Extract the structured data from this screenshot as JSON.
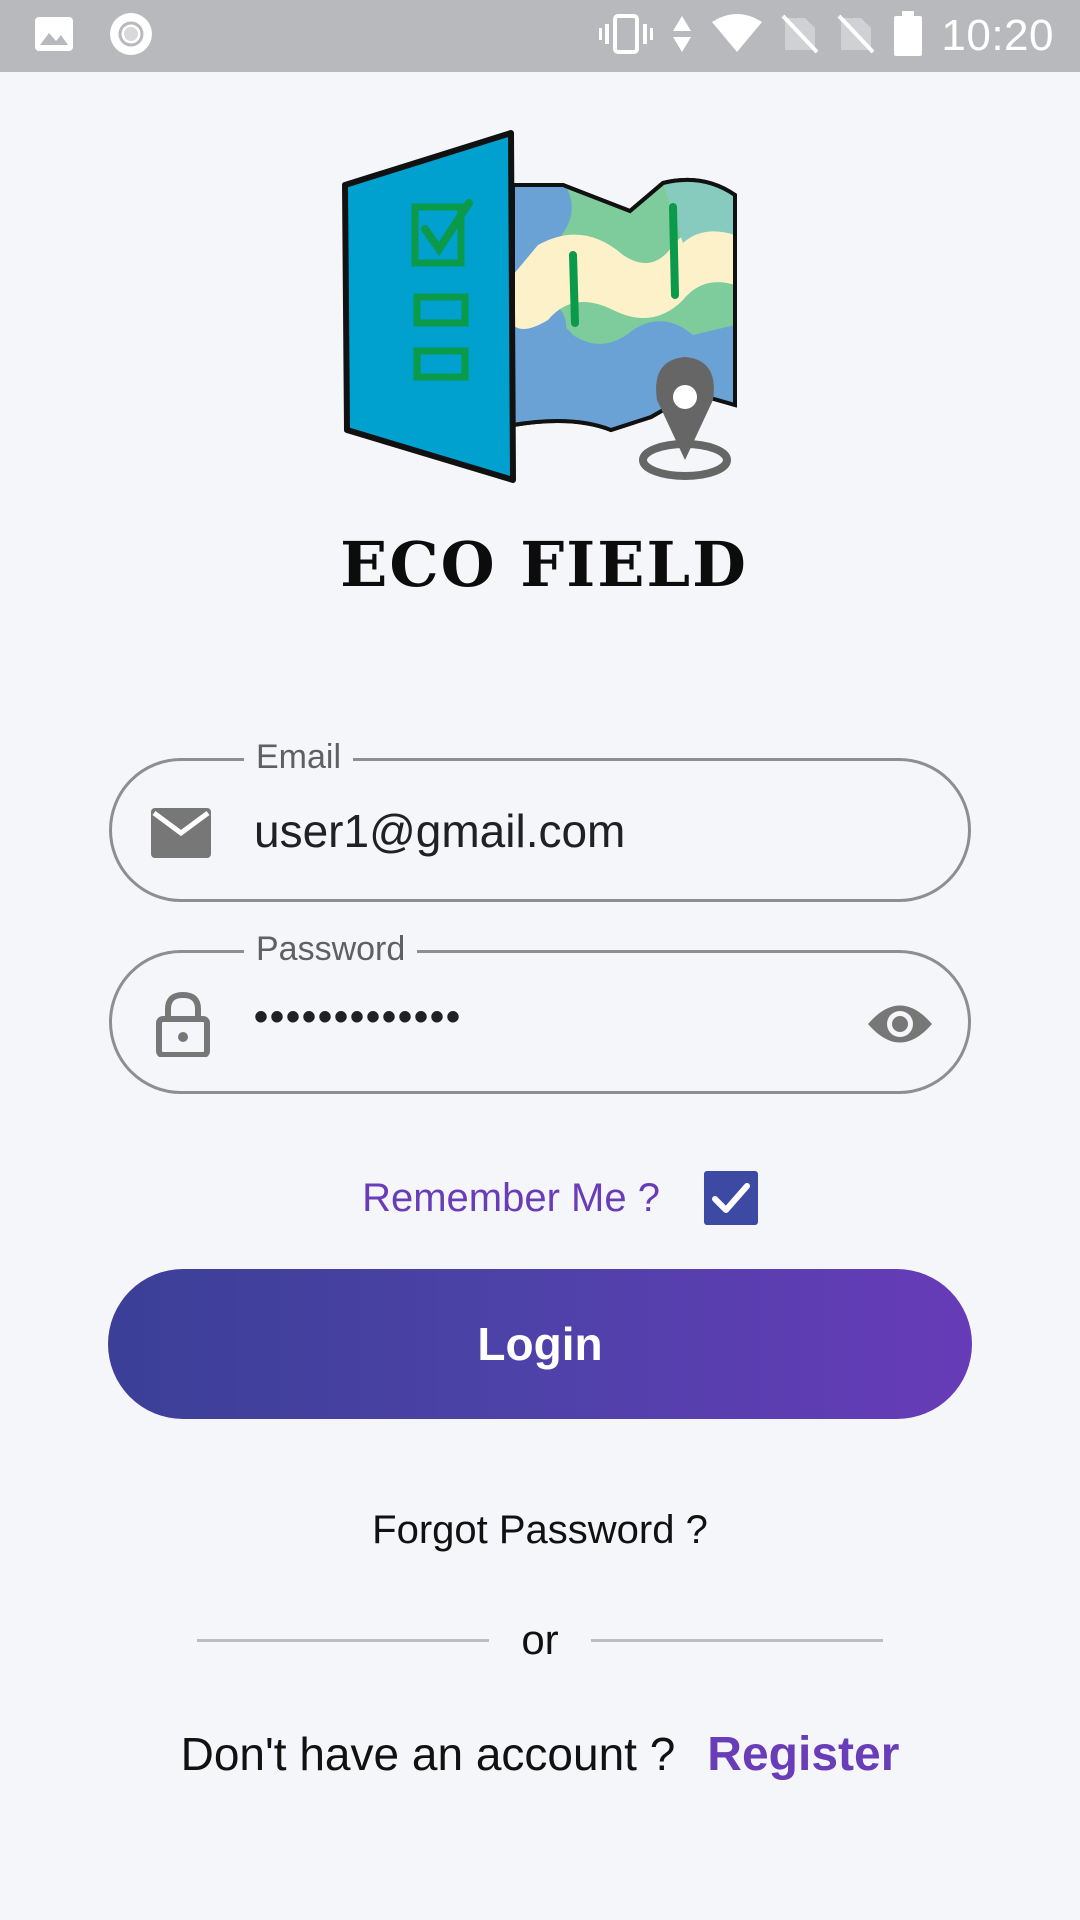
{
  "status_bar": {
    "time": "10:20",
    "icons": [
      "image-icon",
      "circle-icon",
      "vibrate-icon",
      "data-arrows-icon",
      "wifi-icon",
      "no-sim-icon",
      "no-sim-icon",
      "battery-icon"
    ]
  },
  "brand": {
    "name": "ECO FIELD",
    "colors": {
      "panel": "#00a0cf",
      "map_green": "#7ecb9c",
      "map_teal": "#86cbbd",
      "map_blue": "#6aa2d6",
      "map_sand": "#fdf1c9",
      "pin": "#666666",
      "check_green": "#0a9a4a"
    }
  },
  "form": {
    "email": {
      "label": "Email",
      "value": "user1@gmail.com",
      "icon": "mail-icon"
    },
    "password": {
      "label": "Password",
      "value": "•••••••••••••",
      "icon": "lock-icon",
      "toggle_icon": "eye-icon"
    },
    "remember": {
      "label": "Remember Me ?",
      "checked": true
    },
    "login_label": "Login",
    "forgot_label": "Forgot Password ?",
    "divider_text": "or",
    "register_prompt": "Don't have an account ?",
    "register_label": "Register"
  },
  "colors": {
    "accent": "#6a3db8",
    "gradient_start": "#3b3f97",
    "gradient_end": "#673bb8",
    "checkbox": "#3c4aa3",
    "background": "#f5f6fa"
  }
}
